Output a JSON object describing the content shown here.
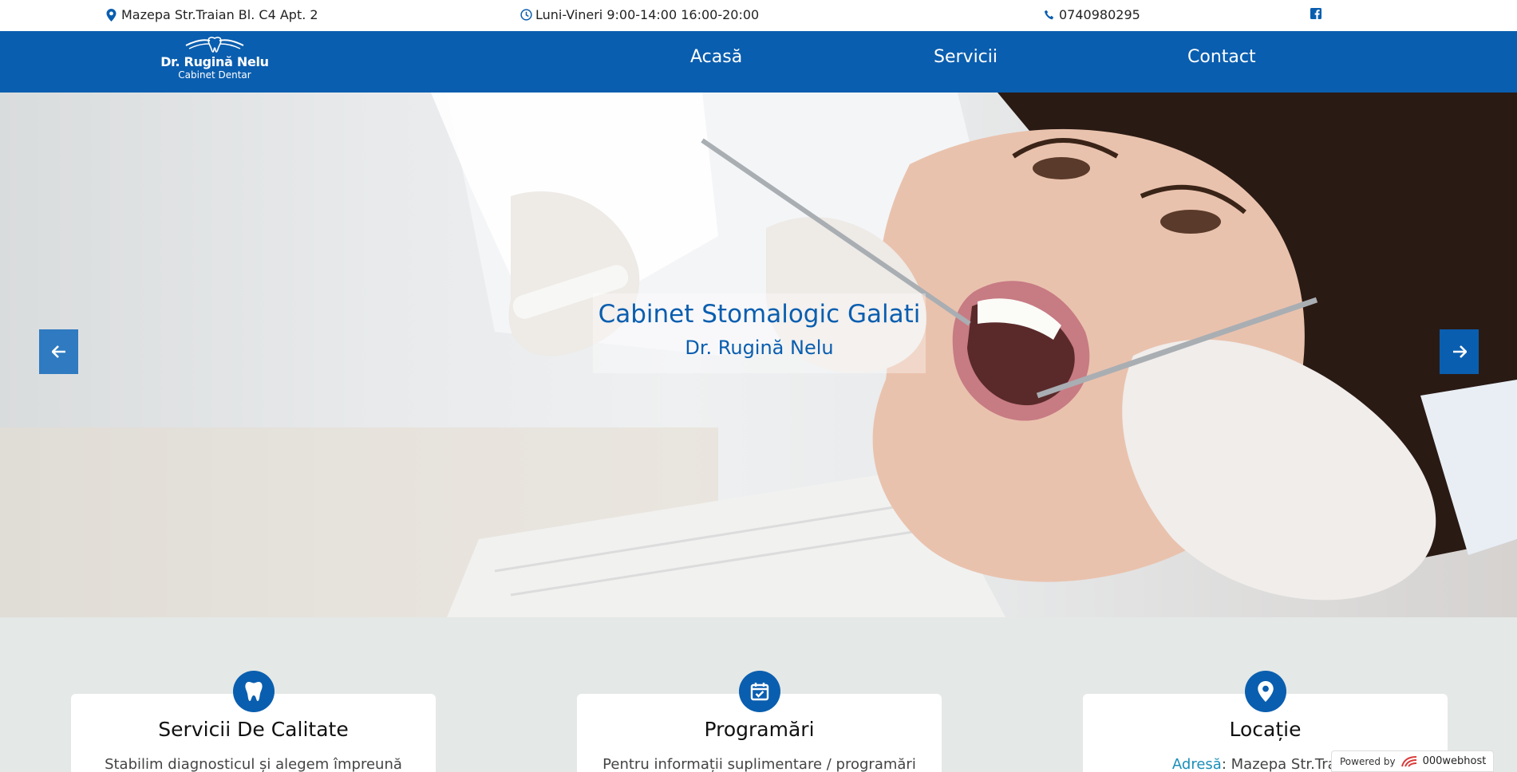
{
  "topbar": {
    "address": "Mazepa Str.Traian Bl. C4 Apt. 2",
    "hours": "Luni-Vineri 9:00-14:00 16:00-20:00",
    "phone": "0740980295",
    "icons": {
      "address": "map-marker-icon",
      "hours": "clock-icon",
      "phone": "phone-icon",
      "social": "facebook-icon"
    }
  },
  "navbar": {
    "logo_name": "Dr. Rugină Nelu",
    "logo_sub": "Cabinet Dentar",
    "links": [
      "Acasă",
      "Servicii",
      "Contact"
    ]
  },
  "hero": {
    "title": "Cabinet Stomalogic Galati",
    "subtitle": "Dr. Rugină Nelu",
    "icons": {
      "prev": "arrow-left-icon",
      "next": "arrow-right-icon"
    }
  },
  "cards": [
    {
      "title": "Servicii De Calitate",
      "text": "Stabilim diagnosticul și alegem împreună",
      "icon": "tooth-icon"
    },
    {
      "title": "Programări",
      "text": "Pentru informații suplimentare / programări",
      "icon": "calendar-check-icon"
    },
    {
      "title": "Locație",
      "label": "Adresă",
      "text": ": Mazepa Str.Traian",
      "icon": "map-marker-icon"
    }
  ],
  "powered": {
    "label": "Powered by",
    "brand": "000webhost"
  },
  "colors": {
    "primary": "#0a5eaf",
    "background": "#e4e8e6",
    "link_accent": "#1a8fb8"
  }
}
